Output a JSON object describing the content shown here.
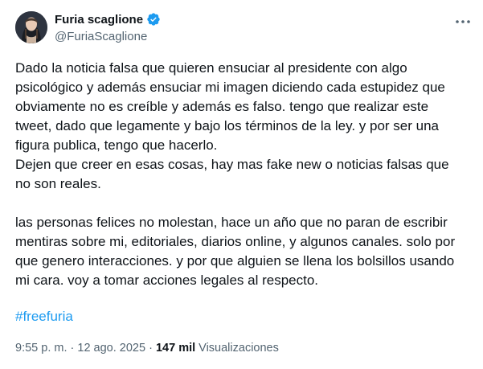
{
  "author": {
    "display_name": "Furia scaglione",
    "handle": "@FuriaScaglione",
    "verified_icon": "verified-badge-icon",
    "verified_color": "#1d9bf0"
  },
  "more_icon": "more-horizontal-icon",
  "tweet": {
    "lines": [
      "Dado la noticia falsa que quieren ensuciar al presidente con algo",
      "psicológico y además ensuciar mi imagen diciendo cada estupidez que",
      "obviamente no es creíble y además es falso. tengo que realizar este",
      "tweet, dado que legamente y bajo los términos de la ley. y por ser una",
      "figura publica, tengo que hacerlo.",
      "Dejen que creer en esas cosas, hay mas fake new o noticias falsas que",
      "no son reales.",
      "",
      "las personas felices no molestan, hace un año que no paran de escribir",
      "mentiras sobre mi, editoriales, diarios online, y algunos canales. solo por",
      "que genero interacciones. y por que alguien se llena los bolsillos usando",
      "mi cara. voy a tomar acciones legales al respecto."
    ],
    "hashtag": "#freefuria"
  },
  "meta": {
    "time": "9:55 p. m.",
    "separator": "·",
    "date": "12 ago. 2025",
    "views_count": "147 mil",
    "views_label": "Visualizaciones"
  },
  "colors": {
    "accent": "#1d9bf0",
    "text_primary": "#0f1419",
    "text_secondary": "#536471"
  }
}
